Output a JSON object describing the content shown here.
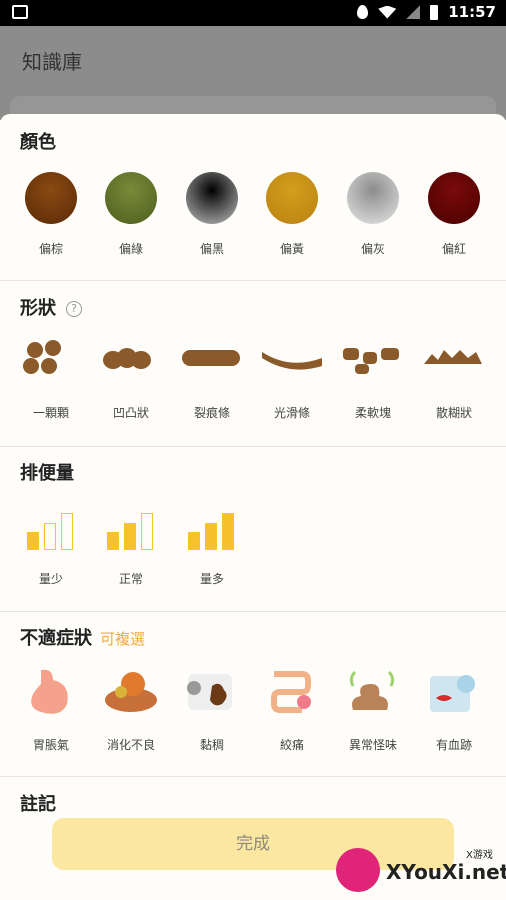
{
  "status_bar": {
    "time": "11:57"
  },
  "app_bar": {
    "title": "知識庫"
  },
  "colors": {
    "title": "顏色",
    "items": [
      {
        "label": "偏棕",
        "color_top": "#8a4a12",
        "color_bottom": "#5a2a06"
      },
      {
        "label": "偏綠",
        "color_top": "#7a8a3a",
        "color_bottom": "#4c5e1c"
      },
      {
        "label": "偏黑",
        "color_top": "#000000",
        "color_bottom": "#bfbfbf"
      },
      {
        "label": "偏黃",
        "color_top": "#d39d1c",
        "color_bottom": "#b98312"
      },
      {
        "label": "偏灰",
        "color_top": "#8c8c8c",
        "color_bottom": "#e6e6e6"
      },
      {
        "label": "偏紅",
        "color_top": "#7a0a0a",
        "color_bottom": "#4a0000"
      }
    ]
  },
  "shape": {
    "title": "形狀",
    "help_icon": "?",
    "items": [
      {
        "label": "一顆顆",
        "icon": "pellets-icon"
      },
      {
        "label": "凹凸狀",
        "icon": "lumpy-icon"
      },
      {
        "label": "裂痕條",
        "icon": "cracked-log-icon"
      },
      {
        "label": "光滑條",
        "icon": "smooth-log-icon"
      },
      {
        "label": "柔軟塊",
        "icon": "soft-blobs-icon"
      },
      {
        "label": "散糊狀",
        "icon": "mushy-icon"
      }
    ]
  },
  "amount": {
    "title": "排便量",
    "items": [
      {
        "label": "量少",
        "filled": 1
      },
      {
        "label": "正常",
        "filled": 2
      },
      {
        "label": "量多",
        "filled": 3
      }
    ]
  },
  "symptoms": {
    "title": "不適症狀",
    "subtitle": "可複選",
    "items": [
      {
        "label": "胃脹氣",
        "icon": "stomach-icon"
      },
      {
        "label": "消化不良",
        "icon": "indigestion-icon"
      },
      {
        "label": "黏稠",
        "icon": "sticky-toilet-paper-icon"
      },
      {
        "label": "絞痛",
        "icon": "intestine-icon"
      },
      {
        "label": "異常怪味",
        "icon": "smelly-poop-icon"
      },
      {
        "label": "有血跡",
        "icon": "bloody-paper-icon"
      }
    ]
  },
  "notes": {
    "title": "註記"
  },
  "done_button": {
    "label": "完成"
  },
  "watermark": {
    "text": "XYouXi.net",
    "small": "X游戏"
  }
}
